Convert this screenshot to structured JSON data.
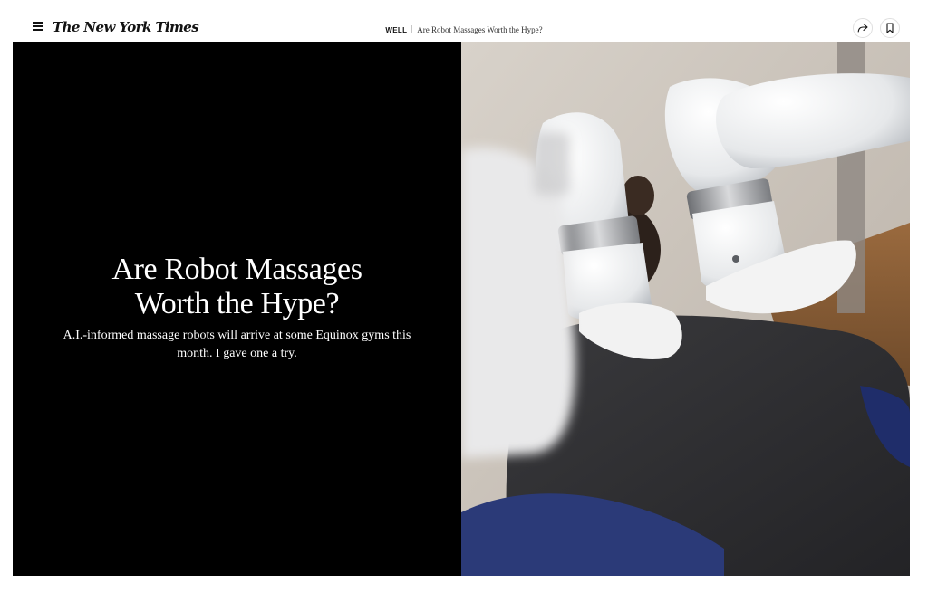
{
  "header": {
    "menu_icon": "hamburger-menu-icon",
    "logo": "The New York Times",
    "section": "WELL",
    "article_title": "Are Robot Massages Worth the Hype?",
    "share_icon": "share-arrow-icon",
    "bookmark_icon": "bookmark-icon"
  },
  "hero": {
    "headline_line1": "Are Robot Massages",
    "headline_line2": "Worth the Hype?",
    "summary": "A.I.-informed massage robots will arrive at some Equinox gyms this month. I gave one a try.",
    "image_subject": "robot-massage-arms-photo"
  },
  "colors": {
    "hero_background": "#000000",
    "headline_text": "#ffffff",
    "page_background": "#ffffff",
    "ink": "#121212"
  }
}
